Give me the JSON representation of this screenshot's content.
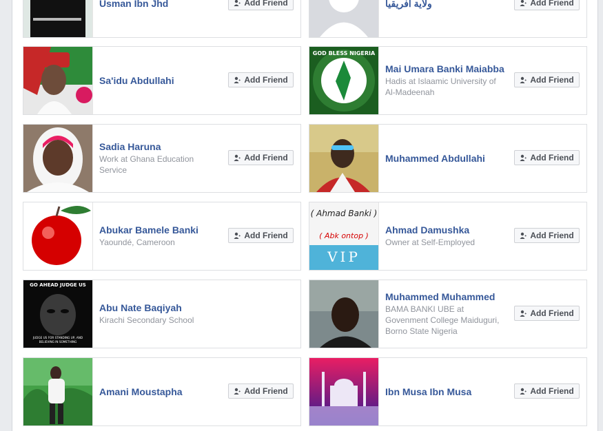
{
  "button_label": "Add Friend",
  "button_icon": "add-friend-icon",
  "suggestions": [
    {
      "name": "Usman Ibn Jhd",
      "lines": []
    },
    {
      "name": "ولاية أفريقيا",
      "lines": []
    },
    {
      "name": "Sa'idu Abdullahi",
      "lines": []
    },
    {
      "name": "Mai Umara Banki Maiabba",
      "lines": [
        "Hadis at Islaamic University of Al-Madeenah"
      ]
    },
    {
      "name": "Sadia Haruna",
      "lines": [
        "Work at Ghana Education Service"
      ]
    },
    {
      "name": "Muhammed Abdullahi",
      "lines": []
    },
    {
      "name": "Abukar Bamele Banki",
      "lines": [
        "Yaoundé, Cameroon"
      ]
    },
    {
      "name": "Ahmad Damushka",
      "lines": [
        "Owner at Self-Employed"
      ]
    },
    {
      "name": "Abu Nate Baqiyah",
      "lines": [
        "Kirachi Secondary School"
      ]
    },
    {
      "name": "Muhammed Muhammed",
      "lines": [
        "BAMA BANKI UBE at Govenment College Maiduguri, Borno State Nigeria"
      ]
    },
    {
      "name": "Amani Moustapha",
      "lines": []
    },
    {
      "name": "Ibn Musa Ibn Musa",
      "lines": []
    }
  ],
  "photo_text": {
    "p3_ring": "GOD BLESS NIGERIA",
    "p7_top": "( Ahmad Banki )",
    "p7_mid": "( Abk ontop )",
    "p7_vip": "VIP",
    "p8_top": "GO AHEAD JUDGE US",
    "p8_bottom1": "JUDGE US FOR STANDING UP, AND",
    "p8_bottom2": "BELIEVING IN SOMETHING"
  }
}
